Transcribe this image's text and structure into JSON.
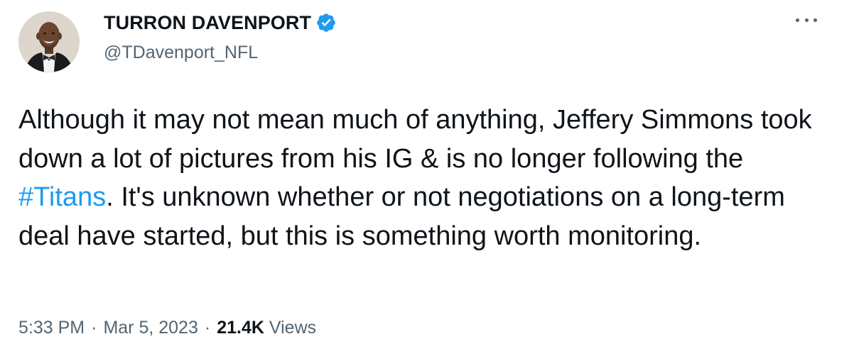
{
  "author": {
    "display_name": "TURRON DAVENPORT",
    "handle": "@TDavenport_NFL",
    "verified": true,
    "avatar_icon": "profile-photo"
  },
  "menu": {
    "icon": "more-options-icon"
  },
  "tweet": {
    "text_before": "Although it may not mean much of anything, Jeffery Simmons took down a lot of pictures from his IG & is no longer following the ",
    "hashtag": "#Titans",
    "text_after": ". It's unknown whether or not negotiations on a long-term deal have started, but this is something worth monitoring."
  },
  "meta": {
    "time": "5:33 PM",
    "separator": "·",
    "date": "Mar 5, 2023",
    "views_count": "21.4K",
    "views_label": "Views"
  },
  "colors": {
    "link": "#1d9bf0",
    "secondary_text": "#536471",
    "primary_text": "#0f1419",
    "verified_badge": "#1d9bf0"
  }
}
